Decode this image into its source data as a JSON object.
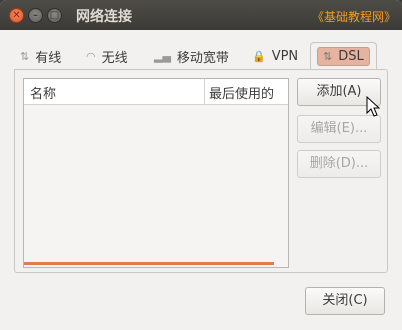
{
  "window": {
    "title": "网络连接",
    "watermark": "《基础教程网》"
  },
  "tabs": [
    {
      "label": "有线",
      "icon": "wired-icon",
      "active": false
    },
    {
      "label": "无线",
      "icon": "wifi-icon",
      "active": false
    },
    {
      "label": "移动宽带",
      "icon": "signal-icon",
      "active": false
    },
    {
      "label": "VPN",
      "icon": "lock-icon",
      "active": false
    },
    {
      "label": "DSL",
      "icon": "dsl-icon",
      "active": true
    }
  ],
  "table": {
    "columns": [
      "名称",
      "最后使用的"
    ],
    "rows": []
  },
  "buttons": {
    "add": "添加(A)",
    "edit": "编辑(E)...",
    "delete": "删除(D)...",
    "close": "关闭(C)"
  },
  "colors": {
    "accent": "#e07a4f",
    "titlebar": "#3c3b37",
    "watermark": "#f39c1f"
  }
}
